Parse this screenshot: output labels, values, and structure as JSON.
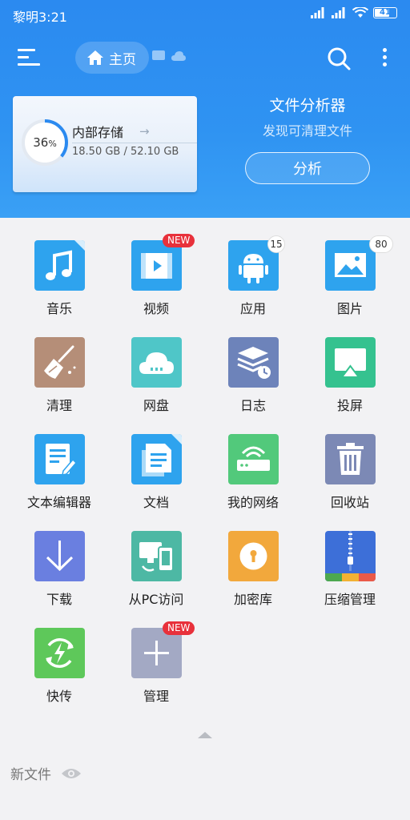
{
  "status": {
    "time": "黎明3:21",
    "battery": "41"
  },
  "header": {
    "home_label": "主页",
    "storage": {
      "percent_label": "36",
      "percent_sign": "%",
      "percent_value": 0.36,
      "title": "内部存储",
      "size": "18.50 GB / 52.10 GB"
    },
    "analyzer": {
      "title": "文件分析器",
      "subtitle": "发现可清理文件",
      "button": "分析"
    }
  },
  "grid": {
    "items": [
      {
        "name": "music",
        "label": "音乐",
        "icon": "music-icon"
      },
      {
        "name": "video",
        "label": "视频",
        "icon": "video-icon",
        "badge": "NEW"
      },
      {
        "name": "apps",
        "label": "应用",
        "icon": "android-icon",
        "count": "15"
      },
      {
        "name": "pictures",
        "label": "图片",
        "icon": "image-icon",
        "count": "80"
      },
      {
        "name": "cleaner",
        "label": "清理",
        "icon": "broom-icon"
      },
      {
        "name": "netdisk",
        "label": "网盘",
        "icon": "cloud-icon"
      },
      {
        "name": "log",
        "label": "日志",
        "icon": "log-icon"
      },
      {
        "name": "cast",
        "label": "投屏",
        "icon": "cast-icon"
      },
      {
        "name": "text-editor",
        "label": "文本编辑器",
        "icon": "text-edit-icon"
      },
      {
        "name": "documents",
        "label": "文档",
        "icon": "document-icon"
      },
      {
        "name": "my-network",
        "label": "我的网络",
        "icon": "router-icon"
      },
      {
        "name": "recycle-bin",
        "label": "回收站",
        "icon": "trash-icon"
      },
      {
        "name": "downloads",
        "label": "下载",
        "icon": "download-icon"
      },
      {
        "name": "pc-access",
        "label": "从PC访问",
        "icon": "pc-phone-icon"
      },
      {
        "name": "vault",
        "label": "加密库",
        "icon": "lock-icon"
      },
      {
        "name": "zip-manager",
        "label": "压缩管理",
        "icon": "zip-icon"
      },
      {
        "name": "quick-send",
        "label": "快传",
        "icon": "transfer-icon"
      },
      {
        "name": "manage",
        "label": "管理",
        "icon": "plus-icon",
        "badge": "NEW"
      }
    ]
  },
  "footer": {
    "new_files_label": "新文件"
  },
  "colors": {
    "header_blue": "#2b8af0",
    "badge_red": "#e8313b"
  }
}
